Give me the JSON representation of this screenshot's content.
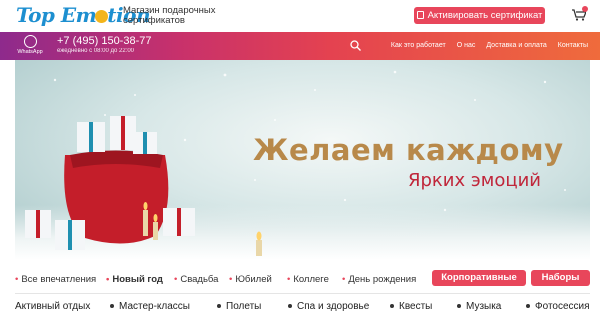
{
  "header": {
    "logo": "Top Emotion",
    "tagline": "Магазин подарочных сертификатов",
    "activate_label": "Активировать сертификат",
    "cart_icon": "cart-icon"
  },
  "navbar": {
    "whatsapp_label": "WhatsApp",
    "phone": "+7 (495) 150-38-77",
    "hours": "ежедневно с 08:00 до 22:00",
    "links": [
      "Как это работает",
      "О нас",
      "Доставка и оплата",
      "Контакты"
    ]
  },
  "hero": {
    "title": "Желаем каждому",
    "subtitle": "Ярких эмоций"
  },
  "categories": {
    "items": [
      "Все впечатления",
      "Новый год",
      "Свадьба",
      "Юбилей",
      "Коллеге",
      "День рождения"
    ],
    "buttons": [
      "Корпоративные",
      "Наборы"
    ]
  },
  "subcategories": [
    "Активный отдых",
    "Мастер-классы",
    "Полеты",
    "Спа и здоровье",
    "Квесты",
    "Музыка",
    "Фотосессия"
  ],
  "colors": {
    "accent": "#e8465b",
    "brand": "#1d8fd0",
    "gold": "#b8894a"
  }
}
